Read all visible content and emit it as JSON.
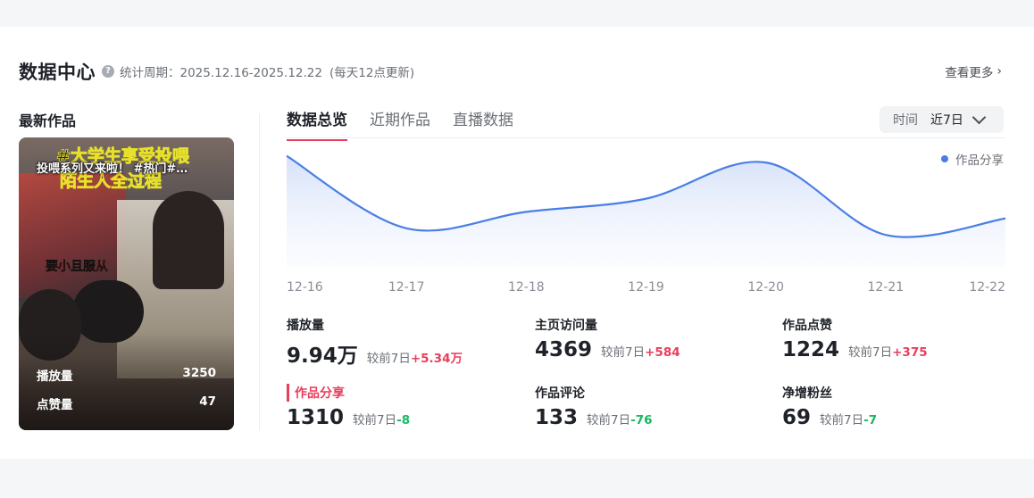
{
  "header": {
    "title": "数据中心",
    "period": "统计周期：2025.12.16-2025.12.22",
    "update_note": "(每天12点更新)",
    "more_label": "查看更多"
  },
  "latest": {
    "label": "最新作品",
    "caption": "投喂系列又来啦！ #热门#…",
    "overlay_line1": "#大学生享受投喂",
    "overlay_line2": "陌生人全过程",
    "overlay_sub": "要小且服从",
    "stats": [
      {
        "label": "播放量",
        "value": "3250"
      },
      {
        "label": "点赞量",
        "value": "47"
      }
    ]
  },
  "tabs": [
    {
      "label": "数据总览",
      "active": true
    },
    {
      "label": "近期作品",
      "active": false
    },
    {
      "label": "直播数据",
      "active": false
    }
  ],
  "time_filter": {
    "label": "时间",
    "value": "近7日"
  },
  "legend": {
    "label": "作品分享",
    "color": "#4a7ee6"
  },
  "chart_data": {
    "type": "area",
    "x": [
      "12-16",
      "12-17",
      "12-18",
      "12-19",
      "12-20",
      "12-21",
      "12-22"
    ],
    "series": [
      {
        "name": "作品分享",
        "values": [
          1330,
          1220,
          1245,
          1265,
          1320,
          1210,
          1235
        ]
      }
    ],
    "ylim": [
      1160,
      1350
    ],
    "grid": false,
    "legend": "top-right"
  },
  "metrics": [
    {
      "label": "播放量",
      "value": "9.94万",
      "compare": "较前7日",
      "delta": "+5.34万",
      "dir": "up"
    },
    {
      "label": "主页访问量",
      "value": "4369",
      "compare": "较前7日",
      "delta": "+584",
      "dir": "up"
    },
    {
      "label": "作品点赞",
      "value": "1224",
      "compare": "较前7日",
      "delta": "+375",
      "dir": "up"
    },
    {
      "label": "作品分享",
      "value": "1310",
      "compare": "较前7日",
      "delta": "-8",
      "dir": "down"
    },
    {
      "label": "作品评论",
      "value": "133",
      "compare": "较前7日",
      "delta": "-76",
      "dir": "down"
    },
    {
      "label": "净增粉丝",
      "value": "69",
      "compare": "较前7日",
      "delta": "-7",
      "dir": "down"
    }
  ]
}
